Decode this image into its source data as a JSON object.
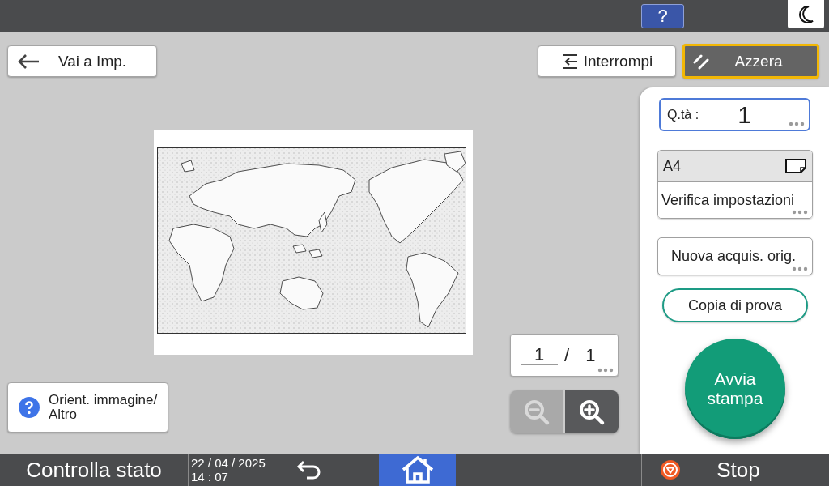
{
  "top_bar": {
    "help_button": {
      "label": "?"
    }
  },
  "toolbar": [
    {
      "kind": "back",
      "label": "Vai a Imp."
    },
    {
      "kind": "interrupt",
      "label": "Interrompi"
    },
    {
      "kind": "reset",
      "label": "Azzera"
    }
  ],
  "preview": {
    "page_counter": {
      "current": "1",
      "separator": "/",
      "total": "1"
    },
    "zoom_buttons": [
      {
        "kind": "zoom_out",
        "disabled": true
      },
      {
        "kind": "zoom_in",
        "disabled": false
      }
    ],
    "orientation_button": {
      "label_lines": [
        "Orient. immagine/",
        "Altro"
      ]
    }
  },
  "right_panel": {
    "quantity": {
      "label": "Q.tà :",
      "value": "1"
    },
    "settings_card": {
      "paper_size": "A4",
      "button": "Verifica impostazioni"
    },
    "rescan_button": "Nuova acquis. orig.",
    "sample_copy_button": "Copia di prova",
    "start_button": "Avvia stampa"
  },
  "bottom_bar": {
    "status_button": "Controlla stato",
    "date": "22 / 04 / 2025",
    "time": "14 : 07",
    "home_button": {
      "selected": true
    },
    "stop_button": "Stop"
  }
}
